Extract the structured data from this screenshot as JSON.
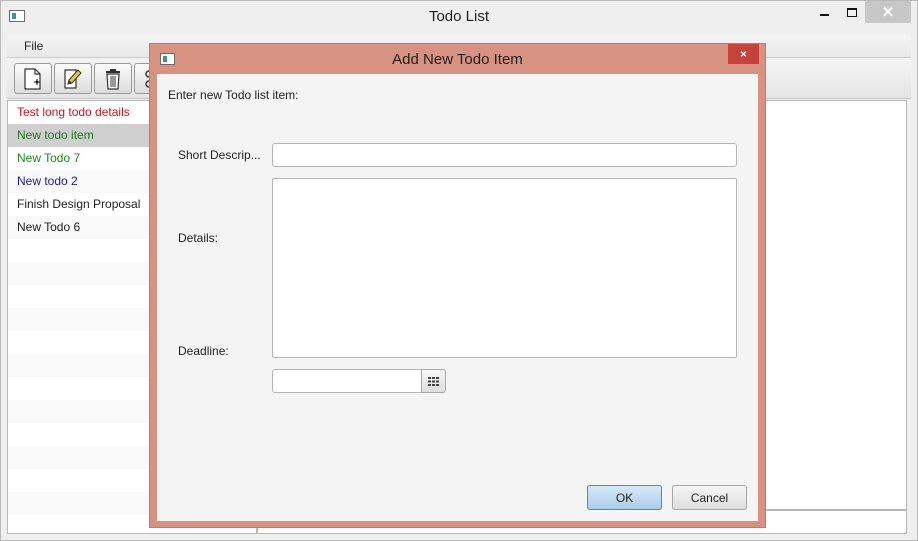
{
  "window": {
    "title": "Todo List"
  },
  "menu": {
    "file_label": "File"
  },
  "toolbar": {
    "buttons": [
      {
        "icon": "new-document-icon"
      },
      {
        "icon": "edit-icon"
      },
      {
        "icon": "trash-icon"
      },
      {
        "icon": "filter-icon"
      }
    ]
  },
  "todo_list": {
    "items": [
      {
        "label": "Test long todo details",
        "color": "#d0121b"
      },
      {
        "label": "New todo item",
        "color": "#1d7a1d",
        "selected": true
      },
      {
        "label": "New Todo 7",
        "color": "#1d8a1d"
      },
      {
        "label": "New todo 2",
        "color": "#1a1aa8"
      },
      {
        "label": "Finish Design Proposal",
        "color": "#222222"
      },
      {
        "label": "New Todo 6",
        "color": "#222222"
      }
    ]
  },
  "dialog": {
    "title": "Add New Todo Item",
    "close_label": "×",
    "header_text": "Enter new Todo list item:",
    "short_label": "Short Descrip...",
    "short_value": "",
    "details_label": "Details:",
    "details_value": "",
    "deadline_label": "Deadline:",
    "deadline_value": "",
    "ok_label": "OK",
    "cancel_label": "Cancel"
  },
  "colors": {
    "dialog_frame": "#d89282",
    "dialog_close": "#c7423a",
    "selected_row": "#cfcfcf"
  }
}
